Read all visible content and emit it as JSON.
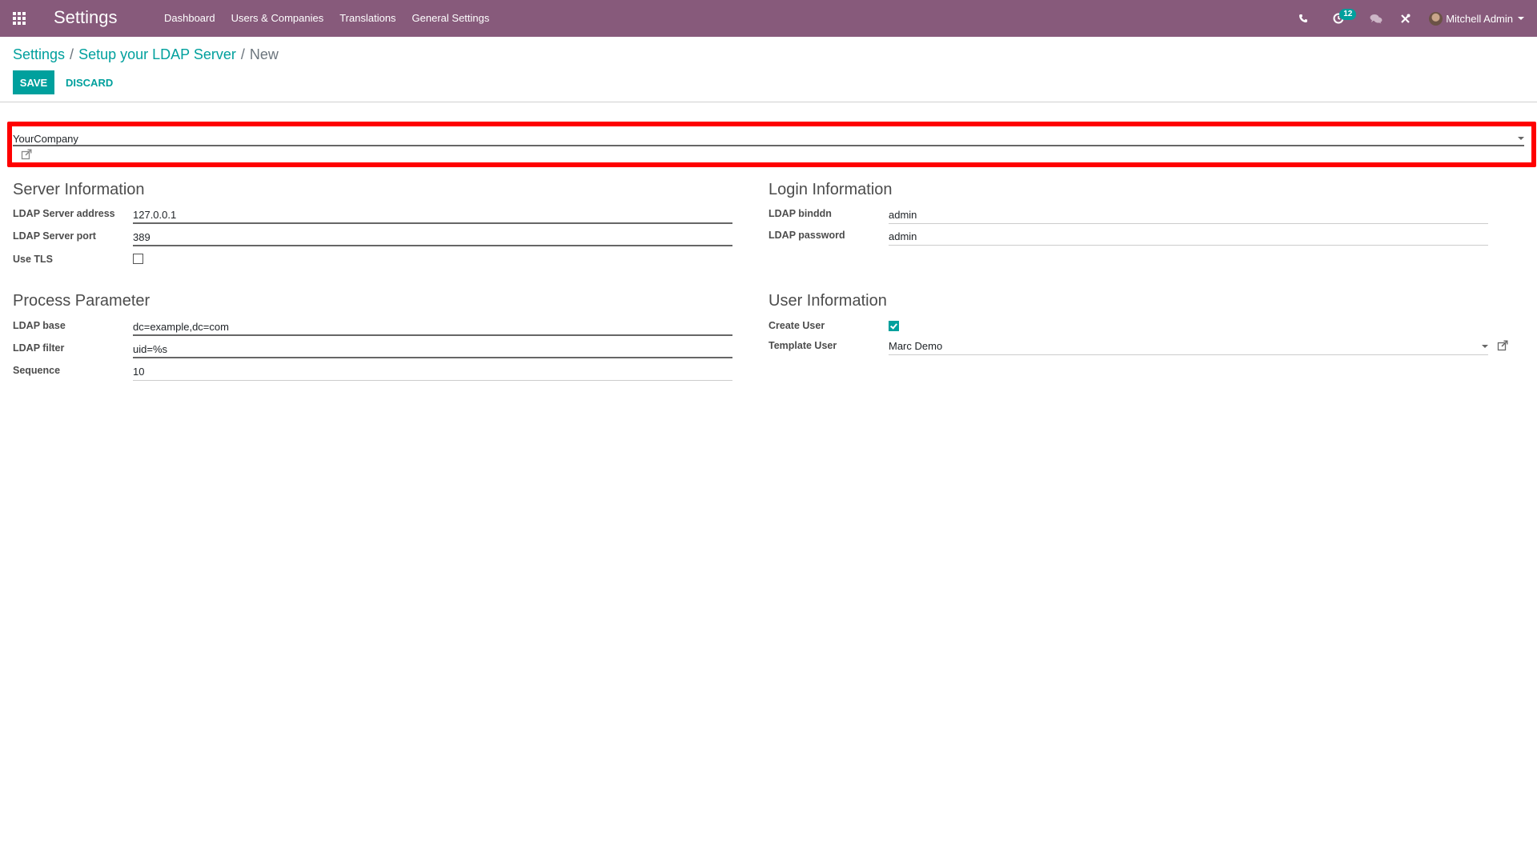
{
  "navbar": {
    "apps_icon": "apps-grid-icon",
    "app_title": "Settings",
    "menu": [
      {
        "label": "Dashboard"
      },
      {
        "label": "Users & Companies"
      },
      {
        "label": "Translations"
      },
      {
        "label": "General Settings"
      }
    ],
    "systray": {
      "phone_icon": "phone-icon",
      "activity_icon": "clock-icon",
      "activity_count": "12",
      "chat_icon": "chat-icon",
      "tools_icon": "tools-icon",
      "user_name": "Mitchell Admin"
    },
    "colors": {
      "background": "#875a7b",
      "accent": "#00a09d"
    }
  },
  "breadcrumb": [
    {
      "label": "Settings"
    },
    {
      "label": "Setup your LDAP Server"
    },
    {
      "label": "New"
    }
  ],
  "breadcrumb_separator": "/",
  "buttons": {
    "save": "Save",
    "discard": "Discard"
  },
  "company": {
    "value": "YourCompany",
    "highlight_color": "#ff0000"
  },
  "server_information": {
    "title": "Server Information",
    "fields": [
      {
        "label": "LDAP Server address",
        "value": "127.0.0.1"
      },
      {
        "label": "LDAP Server port",
        "value": "389"
      },
      {
        "label": "Use TLS",
        "checked": false
      }
    ]
  },
  "login_information": {
    "title": "Login Information",
    "fields": [
      {
        "label": "LDAP binddn",
        "value": "admin"
      },
      {
        "label": "LDAP password",
        "value": "admin"
      }
    ]
  },
  "process_parameter": {
    "title": "Process Parameter",
    "fields": [
      {
        "label": "LDAP base",
        "value": "dc=example,dc=com"
      },
      {
        "label": "LDAP filter",
        "value": "uid=%s"
      },
      {
        "label": "Sequence",
        "value": "10"
      }
    ]
  },
  "user_information": {
    "title": "User Information",
    "fields": [
      {
        "label": "Create User",
        "checked": true
      },
      {
        "label": "Template User",
        "value": "Marc Demo"
      }
    ]
  }
}
